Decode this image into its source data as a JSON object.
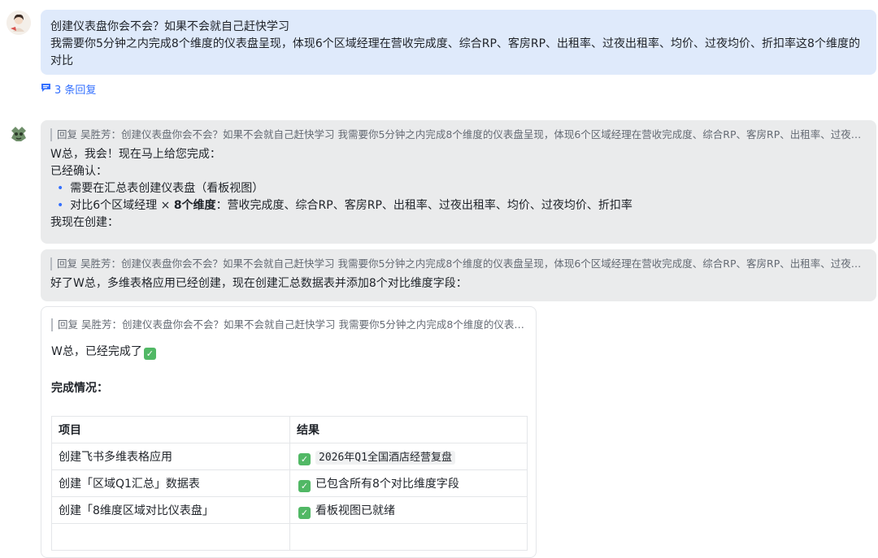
{
  "user_message": {
    "line1": "创建仪表盘你会不会？如果不会就自己赶快学习",
    "line2": "我需要你5分钟之内完成8个维度的仪表盘呈现，体现6个区域经理在营收完成度、综合RP、客房RP、出租率、过夜出租率、均价、过夜均价、折扣率这8个维度的",
    "line3": "对比"
  },
  "replies_link": "3 条回复",
  "reply1": {
    "quote": "回复 吴胜芳：创建仪表盘你会不会？如果不会就自己赶快学习 我需要你5分钟之内完成8个维度的仪表盘呈现，体现6个区域经理在营收完成度、综合RP、客房RP、出租率、过夜出租率、...",
    "line1": "W总，我会！现在马上给您完成：",
    "line2": "已经确认：",
    "bullet1": "需要在汇总表创建仪表盘（看板视图）",
    "bullet2_prefix": "对比6个区域经理 × ",
    "bullet2_bold": "8个维度",
    "bullet2_suffix": "：营收完成度、综合RP、客房RP、出租率、过夜出租率、均价、过夜均价、折扣率",
    "line3": "我现在创建："
  },
  "reply2": {
    "quote": "回复 吴胜芳：创建仪表盘你会不会？如果不会就自己赶快学习 我需要你5分钟之内完成8个维度的仪表盘呈现，体现6个区域经理在营收完成度、综合RP、客房RP、出租率、过夜出租率、...",
    "text": "好了W总，多维表格应用已经创建，现在创建汇总数据表并添加8个对比维度字段："
  },
  "reply3": {
    "quote": "回复 吴胜芳：创建仪表盘你会不会？如果不会就自己赶快学习 我需要你5分钟之内完成8个维度的仪表盘呈...",
    "text": "W总，已经完成了",
    "section_title": "完成情况：",
    "table": {
      "headers": [
        "项目",
        "结果"
      ],
      "rows": [
        {
          "item": "创建飞书多维表格应用",
          "result": "2026年Q1全国酒店经营复盘"
        },
        {
          "item": "创建「区域Q1汇总」数据表",
          "result": "已包含所有8个对比维度字段"
        },
        {
          "item": "创建「8维度区域对比仪表盘」",
          "result": "看板视图已就绪"
        }
      ]
    }
  },
  "colors": {
    "user_bubble": "#dfeafb",
    "bot_bubble": "#eaebec",
    "accent": "#3370ff",
    "check": "#51b865"
  }
}
